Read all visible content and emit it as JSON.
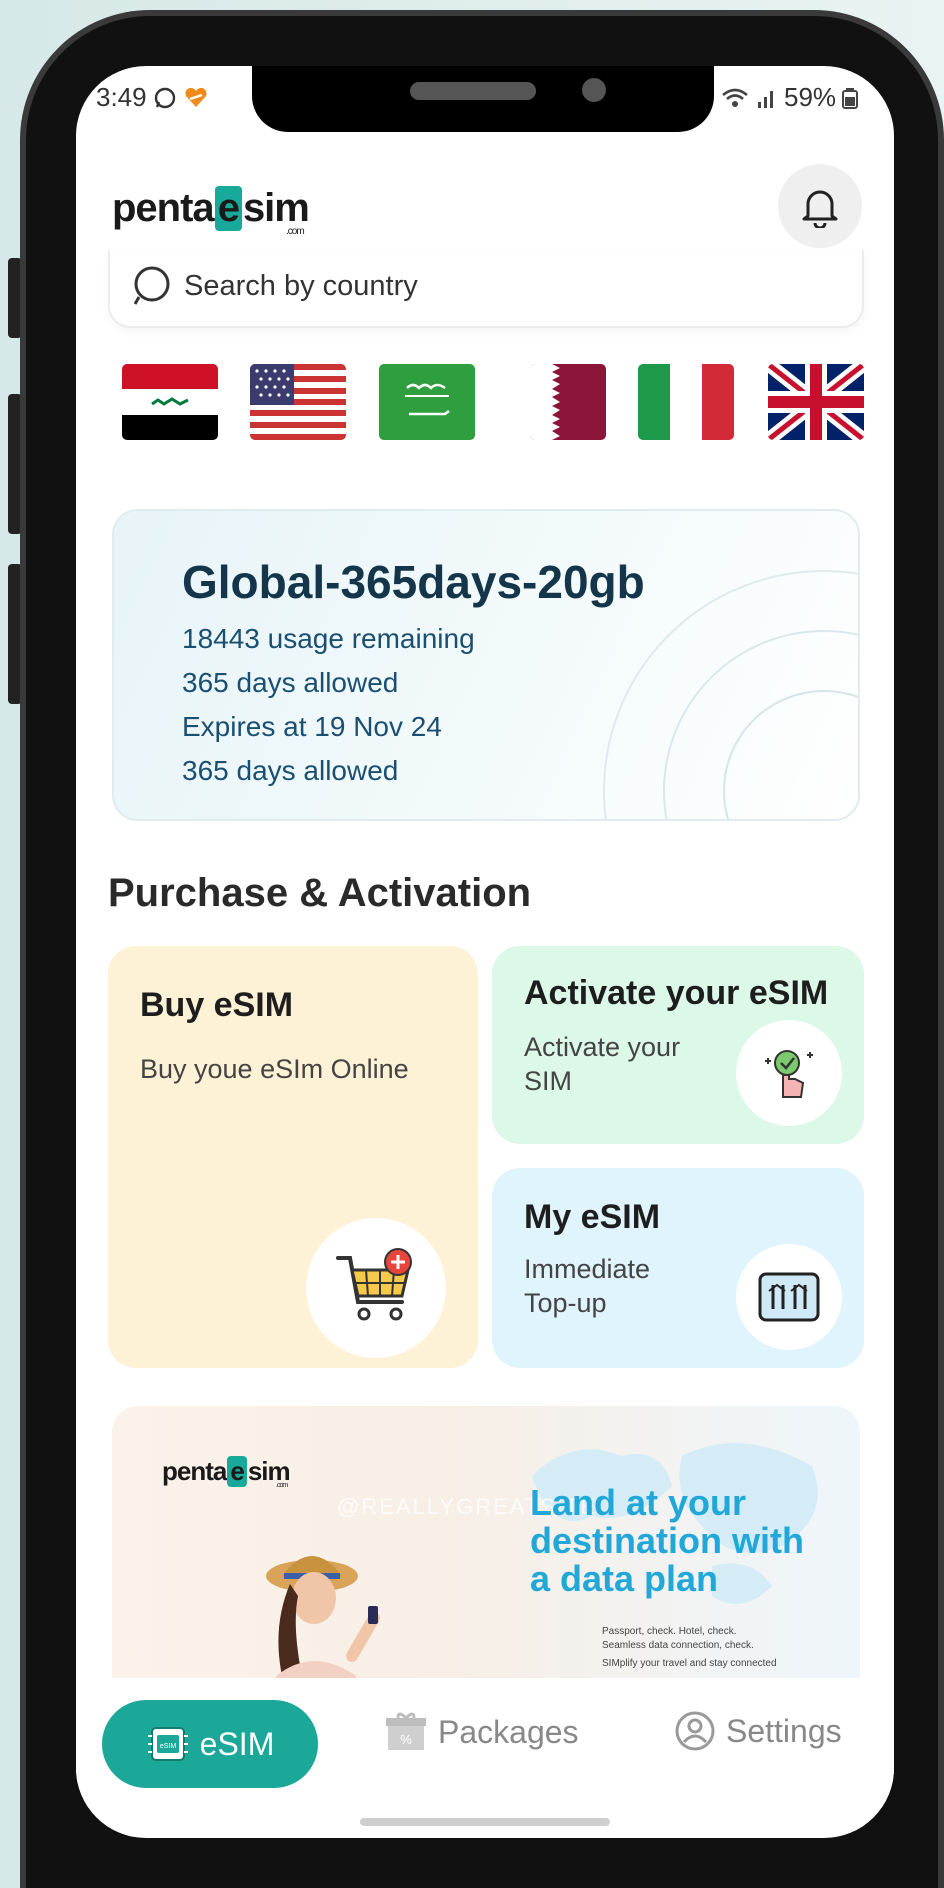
{
  "status_bar": {
    "time": "3:49",
    "battery": "59%"
  },
  "app": {
    "brand_left": "penta",
    "brand_e": "e",
    "brand_right": "sim",
    "brand_com": ".com"
  },
  "search": {
    "placeholder": "Search by country"
  },
  "flags": [
    "iraq-flag",
    "usa-flag",
    "saudi-arabia-flag",
    "qatar-flag",
    "italy-flag",
    "uk-flag"
  ],
  "plan": {
    "title": "Global-365days-20gb",
    "lines": [
      "18443 usage remaining",
      "365 days allowed",
      "Expires at 19 Nov 24",
      "365 days allowed"
    ]
  },
  "section": {
    "title": "Purchase & Activation"
  },
  "cards": {
    "buy": {
      "title": "Buy eSIM",
      "subtitle": "Buy youe eSIm Online"
    },
    "activate": {
      "title": "Activate your eSIM",
      "subtitle_1": "Activate your",
      "subtitle_2": "SIM"
    },
    "my": {
      "title": "My eSIM",
      "subtitle_1": "Immediate",
      "subtitle_2": "Top-up"
    }
  },
  "banner": {
    "brand_left": "penta",
    "brand_e": "e",
    "brand_right": "sim",
    "brand_com": ".com",
    "headline_1": "Land at your",
    "headline_2": "destination with",
    "headline_3": "a data plan",
    "body_1": "Passport, check. Hotel, check.",
    "body_2": "Seamless data connection, check.",
    "body_3": "SIMplify your travel and stay connected",
    "watermark": "@REALLYGREATSITE"
  },
  "nav": {
    "esim": "eSIM",
    "packages": "Packages",
    "settings": "Settings"
  },
  "colors": {
    "accent": "#1ba898",
    "buy_card": "#fdf1d6",
    "activate_card": "#dcf8e8",
    "my_card": "#dff4fc"
  }
}
